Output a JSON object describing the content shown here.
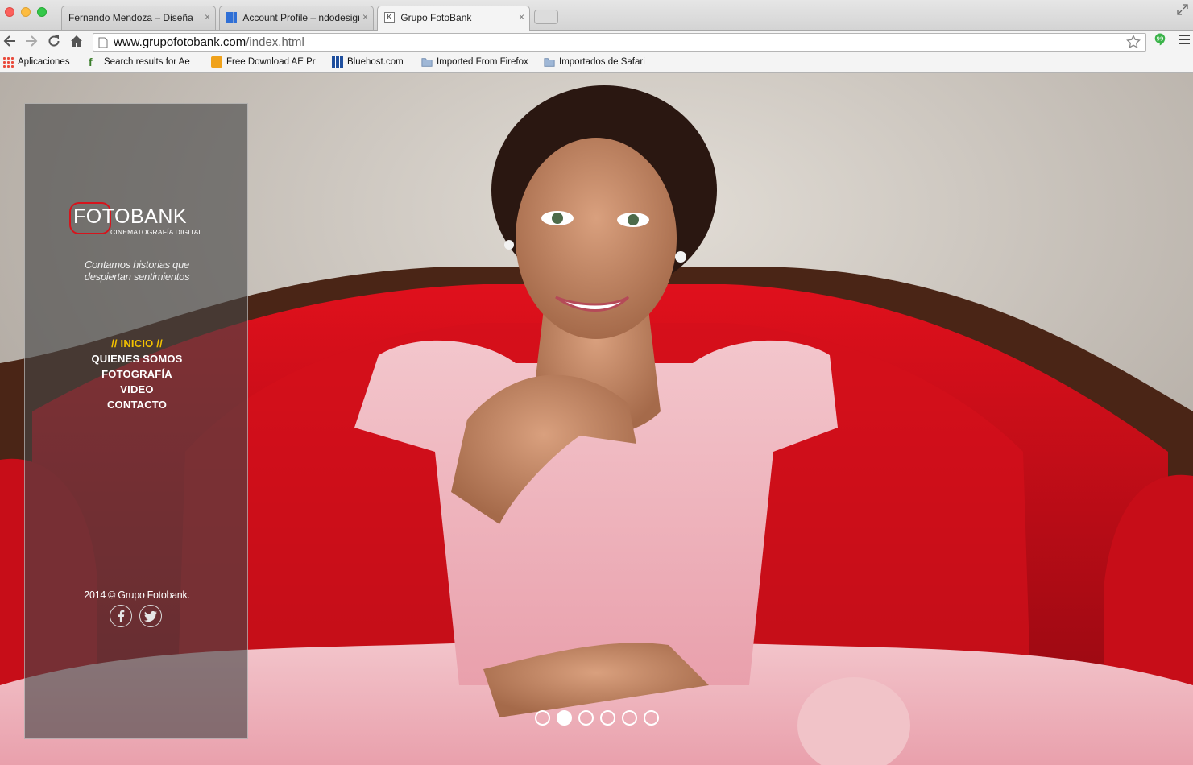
{
  "browser": {
    "tabs": [
      {
        "title": "Fernando Mendoza – Diseñador",
        "active": false
      },
      {
        "title": "Account Profile – ndodesign",
        "active": false
      },
      {
        "title": "Grupo FotoBank",
        "active": true
      }
    ],
    "tab_close_glyph": "×",
    "url_host": "www.grupofotobank.com",
    "url_path": "/index.html",
    "bookmarks": [
      {
        "label": "Aplicaciones",
        "icon": "apps-grid-icon"
      },
      {
        "label": "Search results for Ae",
        "icon": "search-favicon-icon"
      },
      {
        "label": "Free Download AE Pr",
        "icon": "download-favicon-icon"
      },
      {
        "label": "Bluehost.com",
        "icon": "bluehost-favicon-icon"
      },
      {
        "label": "Imported From Firefox",
        "icon": "folder-icon"
      },
      {
        "label": "Importados de Safari",
        "icon": "folder-icon"
      }
    ]
  },
  "site": {
    "logo_text": "FOTOBANK",
    "logo_subtitle": "CINEMATOGRAFÍA DIGITAL",
    "tagline_line1": "Contamos historias que",
    "tagline_line2": "despiertan sentimientos",
    "menu": [
      {
        "label": "// INICIO //",
        "active": true
      },
      {
        "label": "QUIENES SOMOS",
        "active": false
      },
      {
        "label": "FOTOGRAFÍA",
        "active": false
      },
      {
        "label": "VIDEO",
        "active": false
      },
      {
        "label": "CONTACTO",
        "active": false
      }
    ],
    "copyright": "2014 © Grupo Fotobank.",
    "social": [
      "facebook-icon",
      "twitter-icon"
    ]
  },
  "slider": {
    "count": 6,
    "active_index": 1
  },
  "colors": {
    "accent": "#f3c200",
    "brand_red": "#d6141c",
    "sofa_red": "#c8101a",
    "dress_pink": "#f0b5bd"
  }
}
